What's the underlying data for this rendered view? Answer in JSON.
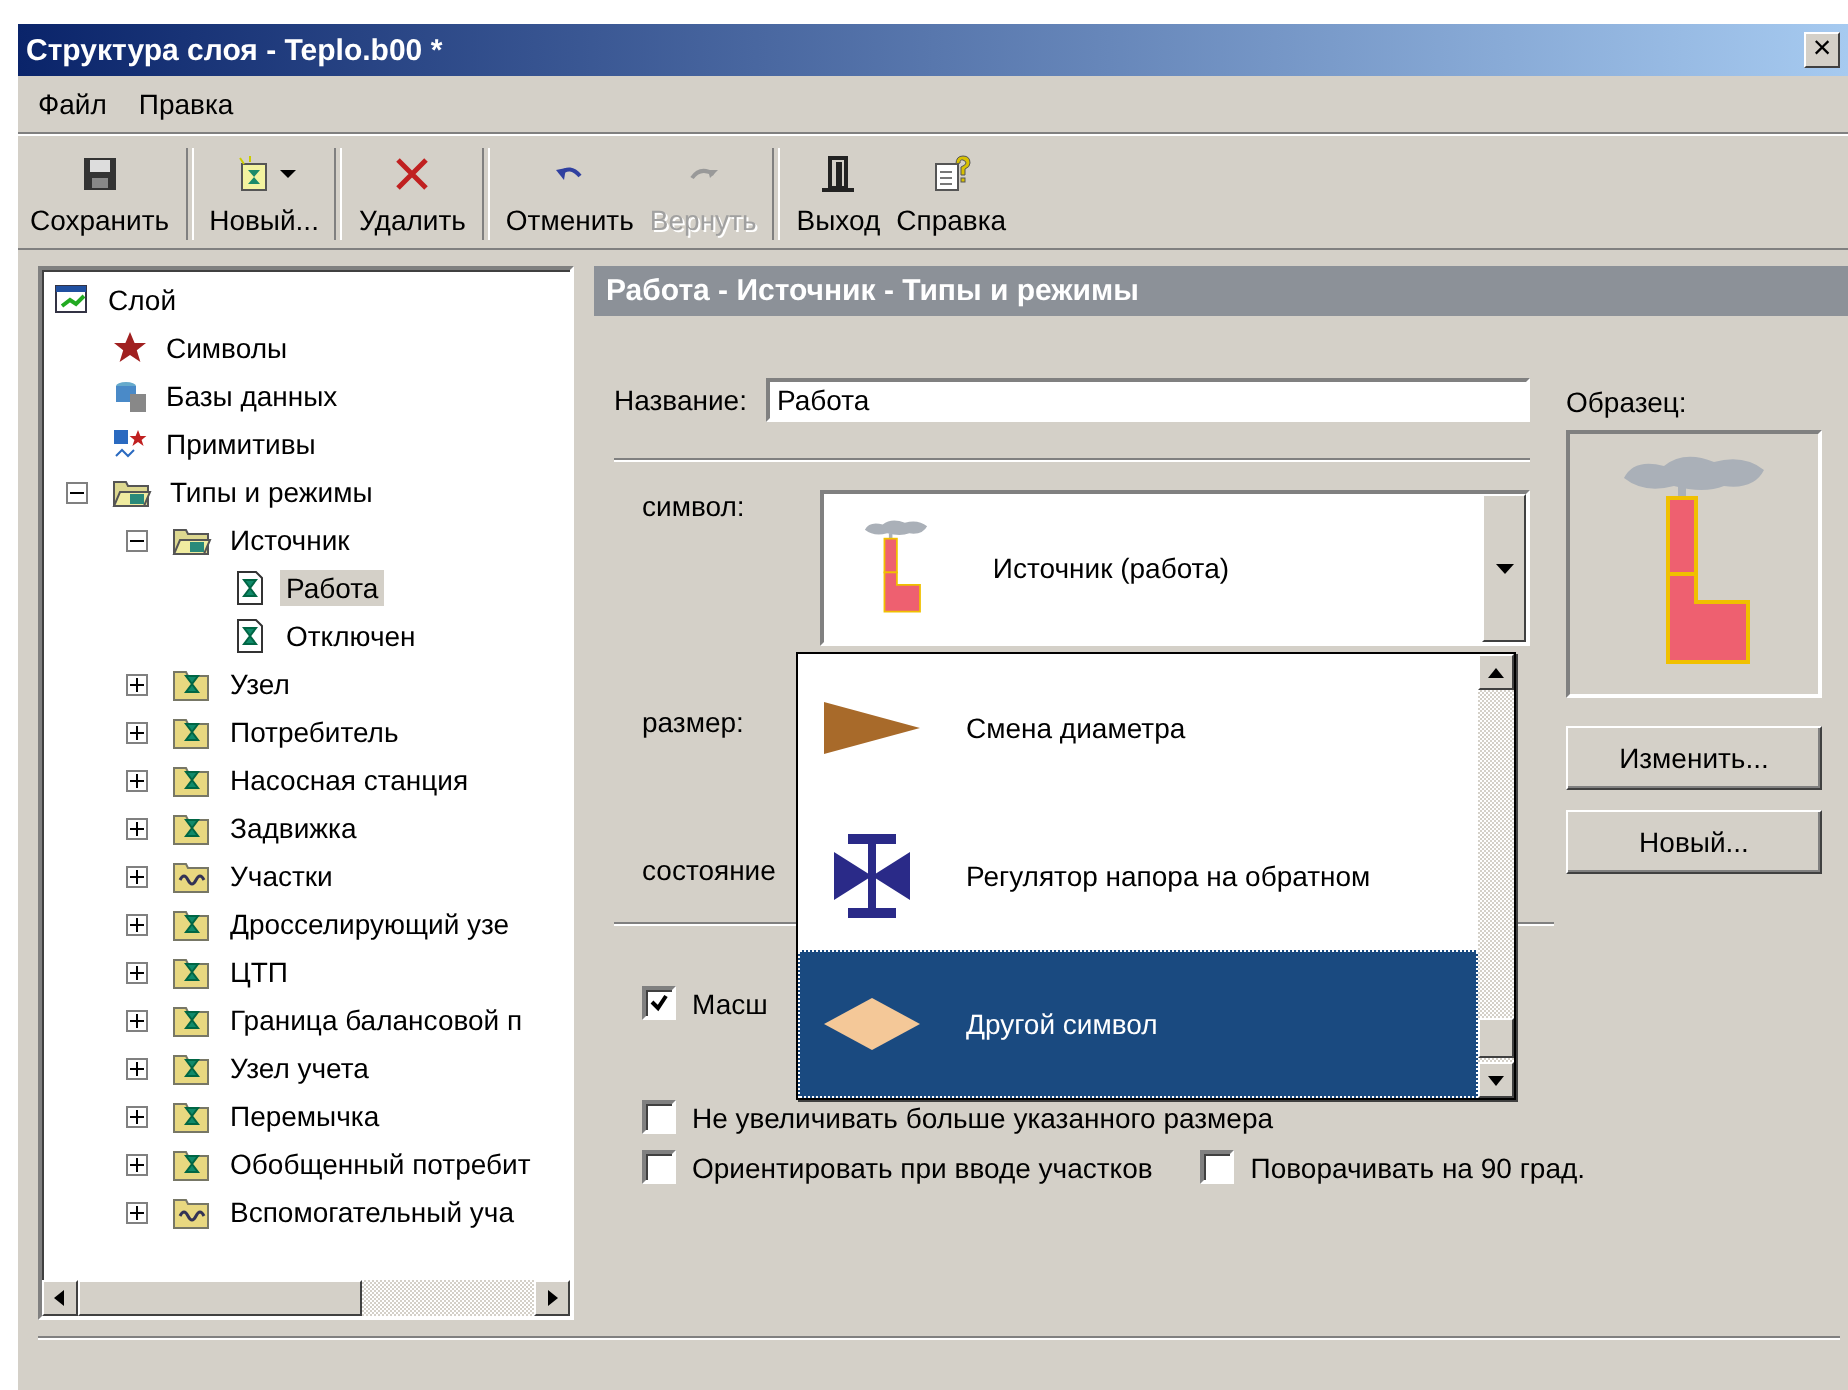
{
  "window": {
    "title": "Структура слоя - Teplo.b00 *",
    "close": "×"
  },
  "menu": [
    "Файл",
    "Правка"
  ],
  "toolbar": [
    {
      "label": "Сохранить",
      "kind": "save",
      "disabled": false,
      "dropdown": false
    },
    {
      "label": "Новый...",
      "kind": "new",
      "disabled": false,
      "dropdown": true
    },
    {
      "label": "Удалить",
      "kind": "delete",
      "disabled": false,
      "dropdown": false
    },
    {
      "label": "Отменить",
      "kind": "undo",
      "disabled": false,
      "dropdown": false
    },
    {
      "label": "Вернуть",
      "kind": "redo",
      "disabled": true,
      "dropdown": false
    },
    {
      "label": "Выход",
      "kind": "exit",
      "disabled": false,
      "dropdown": false
    },
    {
      "label": "Справка",
      "kind": "help",
      "disabled": false,
      "dropdown": false
    }
  ],
  "tree": [
    {
      "label": "Слой",
      "kind": "layer",
      "selected": false,
      "children": [
        {
          "label": "Символы",
          "kind": "star",
          "selected": false
        },
        {
          "label": "Базы данных",
          "kind": "database",
          "selected": false
        },
        {
          "label": "Примитивы",
          "kind": "primitives",
          "selected": false
        },
        {
          "label": "Типы и режимы",
          "kind": "folder-open",
          "selected": false,
          "expanded": true,
          "children": [
            {
              "label": "Источник",
              "kind": "folder-open",
              "selected": false,
              "expanded": true,
              "children": [
                {
                  "label": "Работа",
                  "kind": "doc",
                  "selected": true
                },
                {
                  "label": "Отключен",
                  "kind": "doc",
                  "selected": false
                }
              ]
            },
            {
              "label": "Узел",
              "kind": "folder",
              "selected": false,
              "expanded": false
            },
            {
              "label": "Потребитель",
              "kind": "folder",
              "selected": false,
              "expanded": false
            },
            {
              "label": "Насосная станция",
              "kind": "folder",
              "selected": false,
              "expanded": false
            },
            {
              "label": "Задвижка",
              "kind": "folder",
              "selected": false,
              "expanded": false
            },
            {
              "label": "Участки",
              "kind": "folder-wave",
              "selected": false,
              "expanded": false
            },
            {
              "label": "Дросселирующий узе",
              "kind": "folder",
              "selected": false,
              "expanded": false
            },
            {
              "label": "ЦТП",
              "kind": "folder",
              "selected": false,
              "expanded": false
            },
            {
              "label": "Граница балансовой п",
              "kind": "folder",
              "selected": false,
              "expanded": false
            },
            {
              "label": "Узел учета",
              "kind": "folder",
              "selected": false,
              "expanded": false
            },
            {
              "label": "Перемычка",
              "kind": "folder",
              "selected": false,
              "expanded": false
            },
            {
              "label": "Обобщенный потребит",
              "kind": "folder",
              "selected": false,
              "expanded": false
            },
            {
              "label": "Вспомогательный уча",
              "kind": "folder-wave",
              "selected": false,
              "expanded": false
            }
          ]
        }
      ]
    }
  ],
  "panel": {
    "header": "Работа - Источник - Типы и режимы",
    "name_label": "Название:",
    "name_value": "Работа",
    "sample_label": "Образец:",
    "symbol_label": "символ:",
    "symbol_value": "Источник (работа)",
    "size_label": "размер:",
    "state_label": "состояние",
    "buttons": [
      "Изменить...",
      "Новый..."
    ],
    "symbol_list": [
      {
        "label": "Смена диаметра",
        "kind": "triangle",
        "selected": false
      },
      {
        "label": "Регулятор напора на обратном",
        "kind": "regulator",
        "selected": false
      },
      {
        "label": "Другой символ",
        "kind": "diamond",
        "selected": true
      }
    ],
    "checkboxes": [
      {
        "label": "Масш",
        "checked": true
      },
      {
        "label": "Не увеличивать больше указанного размера",
        "checked": false
      },
      {
        "label": "Ориентировать при вводе участков",
        "checked": false
      },
      {
        "label": "Поворачивать на 90 град.",
        "checked": false
      }
    ]
  }
}
